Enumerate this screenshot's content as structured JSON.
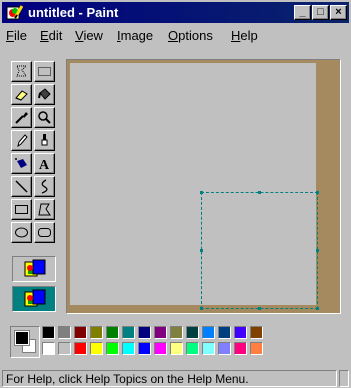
{
  "window": {
    "title": "untitled - Paint",
    "icon": "paint-app-icon",
    "controls": [
      {
        "name": "minimize",
        "glyph": "_"
      },
      {
        "name": "maximize",
        "glyph": "□"
      },
      {
        "name": "close",
        "glyph": "×"
      }
    ]
  },
  "menu": [
    "File",
    "Edit",
    "View",
    "Image",
    "Options",
    "Help"
  ],
  "tools": [
    {
      "name": "free-form-select",
      "icon": "free-form-select-icon",
      "selected": false
    },
    {
      "name": "select",
      "icon": "rect-select-icon",
      "selected": false
    },
    {
      "name": "eraser",
      "icon": "eraser-icon",
      "selected": false
    },
    {
      "name": "fill",
      "icon": "paint-bucket-icon",
      "selected": false
    },
    {
      "name": "pick-color",
      "icon": "eyedropper-icon",
      "selected": false
    },
    {
      "name": "magnifier",
      "icon": "magnifier-icon",
      "selected": false
    },
    {
      "name": "pencil",
      "icon": "pencil-icon",
      "selected": false
    },
    {
      "name": "brush",
      "icon": "brush-icon",
      "selected": false
    },
    {
      "name": "airbrush",
      "icon": "airbrush-icon",
      "selected": false
    },
    {
      "name": "text",
      "icon": "text-icon",
      "selected": false,
      "glyph": "A"
    },
    {
      "name": "line",
      "icon": "line-icon",
      "selected": false
    },
    {
      "name": "curve",
      "icon": "curve-icon",
      "selected": false
    },
    {
      "name": "rectangle",
      "icon": "rectangle-icon",
      "selected": false
    },
    {
      "name": "polygon",
      "icon": "polygon-icon",
      "selected": false
    },
    {
      "name": "ellipse",
      "icon": "ellipse-icon",
      "selected": false
    },
    {
      "name": "rounded-rectangle",
      "icon": "rounded-rectangle-icon",
      "selected": false
    }
  ],
  "tool_options": [
    {
      "name": "opaque-background",
      "icon": "opaque-selection-icon",
      "selected": false
    },
    {
      "name": "transparent-background",
      "icon": "transparent-selection-icon",
      "selected": true
    }
  ],
  "current_colors": {
    "foreground": "#000000",
    "background": "#ffffff"
  },
  "palette_top": [
    "#000000",
    "#808080",
    "#800000",
    "#808000",
    "#008000",
    "#008080",
    "#000080",
    "#800080",
    "#808040",
    "#004040",
    "#0080ff",
    "#004080",
    "#4000ff",
    "#804000"
  ],
  "palette_bottom": [
    "#ffffff",
    "#c0c0c0",
    "#ff0000",
    "#ffff00",
    "#00ff00",
    "#00ffff",
    "#0000ff",
    "#ff00ff",
    "#ffff80",
    "#00ff80",
    "#80ffff",
    "#8080ff",
    "#ff0080",
    "#ff8040"
  ],
  "colors": {
    "title_bar": "#000080",
    "workspace": "#a68a5f",
    "canvas": "#c0c0c0",
    "selection": "#008080"
  },
  "status": {
    "text": "For Help, click Help Topics on the Help Menu."
  }
}
